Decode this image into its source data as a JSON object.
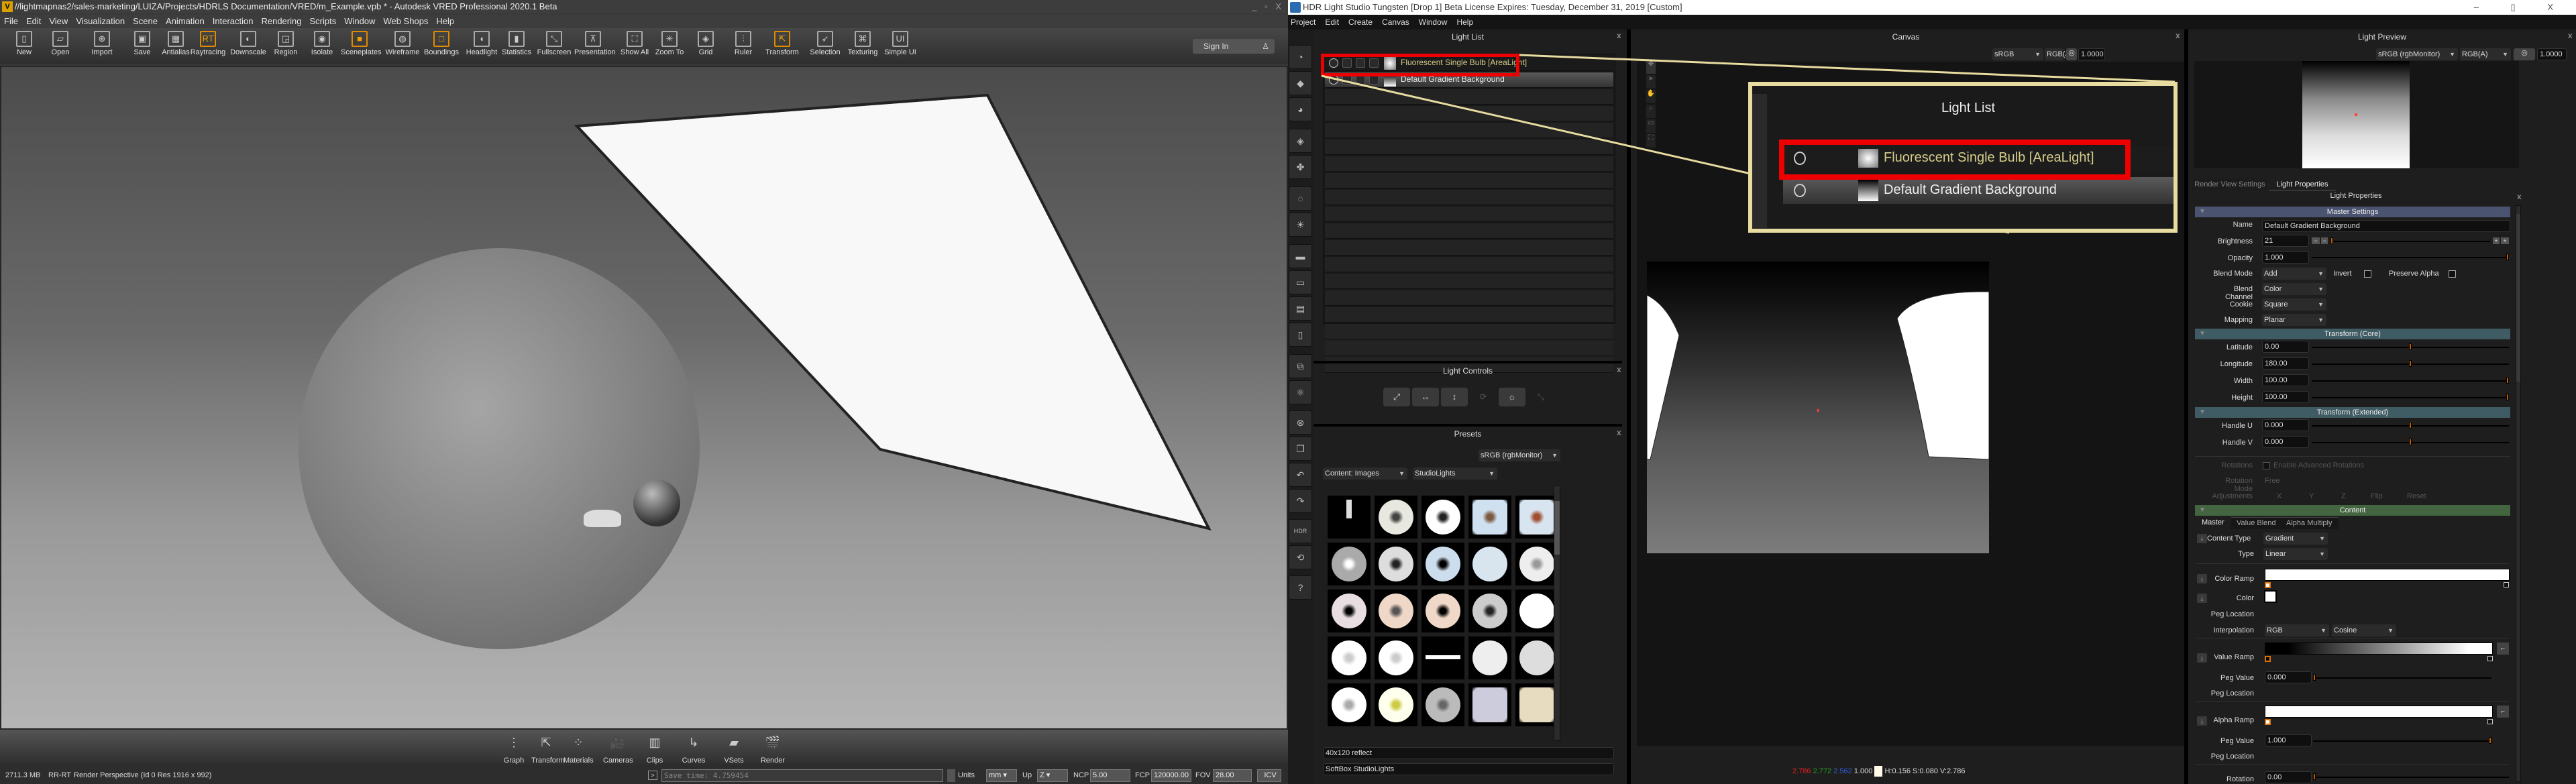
{
  "vred": {
    "title": "//lightmapnas2/sales-marketing/LUIZA/Projects/HDRLS Documentation/VRED/m_Example.vpb * - Autodesk VRED Professional 2020.1 Beta",
    "menu": [
      "File",
      "Edit",
      "View",
      "Visualization",
      "Scene",
      "Animation",
      "Interaction",
      "Rendering",
      "Scripts",
      "Window",
      "Web Shops",
      "Help"
    ],
    "toolbar": [
      {
        "label": "New",
        "icon": "new-file-icon",
        "glyph": "▯"
      },
      {
        "label": "Open",
        "icon": "open-folder-icon",
        "glyph": "▱"
      },
      {
        "label": "Import",
        "icon": "import-icon",
        "glyph": "⊕"
      },
      {
        "label": "Save",
        "icon": "save-icon",
        "glyph": "▣"
      },
      {
        "label": "Antialias",
        "icon": "antialias-icon",
        "glyph": "▦"
      },
      {
        "label": "Raytracing",
        "icon": "raytracing-icon",
        "glyph": "RT"
      },
      {
        "label": "Downscale",
        "icon": "downscale-icon",
        "glyph": "◐"
      },
      {
        "label": "Region",
        "icon": "region-icon",
        "glyph": "◲"
      },
      {
        "label": "Isolate",
        "icon": "isolate-icon",
        "glyph": "◉"
      },
      {
        "label": "Sceneplates",
        "icon": "sceneplates-icon",
        "glyph": "■"
      },
      {
        "label": "Wireframe",
        "icon": "wireframe-icon",
        "glyph": "◍"
      },
      {
        "label": "Boundings",
        "icon": "boundings-icon",
        "glyph": "□"
      },
      {
        "label": "Headlight",
        "icon": "headlight-icon",
        "glyph": "◖"
      },
      {
        "label": "Statistics",
        "icon": "statistics-icon",
        "glyph": "▮"
      },
      {
        "label": "Fullscreen",
        "icon": "fullscreen-icon",
        "glyph": "⤡"
      },
      {
        "label": "Presentation",
        "icon": "presentation-icon",
        "glyph": "⊼"
      },
      {
        "label": "Show All",
        "icon": "show-all-icon",
        "glyph": "⛶"
      },
      {
        "label": "Zoom To",
        "icon": "zoom-to-icon",
        "glyph": "✳"
      },
      {
        "label": "Grid",
        "icon": "grid-icon",
        "glyph": "◈"
      },
      {
        "label": "Ruler",
        "icon": "ruler-icon",
        "glyph": "⫶"
      },
      {
        "label": "Transform",
        "icon": "transform-icon",
        "glyph": "⇱"
      },
      {
        "label": "Selection",
        "icon": "selection-icon",
        "glyph": "➶"
      },
      {
        "label": "Texturing",
        "icon": "texturing-icon",
        "glyph": "⌘"
      },
      {
        "label": "Simple UI",
        "icon": "simple-ui-icon",
        "glyph": "UI"
      }
    ],
    "sign_in": "Sign In",
    "dock": [
      {
        "label": "Graph",
        "icon": "graph-icon",
        "glyph": "⋮"
      },
      {
        "label": "Transform",
        "icon": "transform-icon",
        "glyph": "⇱"
      },
      {
        "label": "Materials",
        "icon": "materials-icon",
        "glyph": "⁘"
      },
      {
        "label": "Cameras",
        "icon": "cameras-icon",
        "glyph": "🎥"
      },
      {
        "label": "Clips",
        "icon": "clips-icon",
        "glyph": "▥"
      },
      {
        "label": "Curves",
        "icon": "curves-icon",
        "glyph": "↳"
      },
      {
        "label": "VSets",
        "icon": "vsets-icon",
        "glyph": "▰"
      },
      {
        "label": "Render",
        "icon": "render-icon",
        "glyph": "🎬"
      }
    ],
    "status": {
      "memory": "2711.3 MB",
      "mode": "RR-RT",
      "render": "Render Perspective (Id 0 Res 1916 x 992)",
      "console": "Save time: 4.759454",
      "units_label": "Units",
      "units": "mm",
      "up_label": "Up",
      "up": "Z",
      "ncp_label": "NCP",
      "ncp": "5.00",
      "fcp_label": "FCP",
      "fcp": "120000.00",
      "fov_label": "FOV",
      "fov": "28.00",
      "icv": "ICV"
    }
  },
  "hdr": {
    "title": "HDR Light Studio Tungsten [Drop 1] Beta License Expires: Tuesday, December 31, 2019  [Custom]",
    "menu": [
      "Project",
      "Edit",
      "Create",
      "Canvas",
      "Window",
      "Help"
    ],
    "light_list": {
      "title": "Light List",
      "items": [
        {
          "name": "Fluorescent Single Bulb [AreaLight]",
          "selected": true
        },
        {
          "name": "Default Gradient Background",
          "selected": false
        }
      ]
    },
    "light_controls": {
      "title": "Light Controls"
    },
    "presets": {
      "title": "Presets",
      "color_space": "sRGB (rgbMonitor)",
      "content": "Content: Images",
      "category": "StudioLights",
      "selected_name": "40x120 reflect",
      "selected_category": "SoftBox StudioLights"
    },
    "canvas": {
      "title": "Canvas",
      "color_space": "sRGB (rgbMonitor)",
      "channel": "RGB(A)",
      "exposure": "1.0000",
      "callout_title": "Light List",
      "readout": {
        "r": "2.786",
        "g": "2.772",
        "b": "2.562",
        "a": "1.000",
        "hsv": "H:0.156 S:0.080 V:2.786"
      }
    },
    "light_preview": {
      "title": "Light Preview",
      "color_space": "sRGB (rgbMonitor)",
      "channel": "RGB(A)",
      "exposure": "1.0000"
    },
    "props": {
      "tabs": [
        "Render View Settings",
        "Light Properties"
      ],
      "title": "Light Properties",
      "master_settings": "Master Settings",
      "name_label": "Name",
      "name": "Default Gradient Background",
      "brightness_label": "Brightness",
      "brightness": "21",
      "opacity_label": "Opacity",
      "opacity": "1.000",
      "blend_mode_label": "Blend Mode",
      "blend_mode": "Add",
      "invert_label": "Invert",
      "preserve_alpha_label": "Preserve Alpha",
      "blend_channel_label": "Blend Channel",
      "blend_channel": "Color",
      "cookie_label": "Cookie",
      "cookie": "Square",
      "mapping_label": "Mapping",
      "mapping": "Planar",
      "transform_core": "Transform (Core)",
      "latitude_label": "Latitude",
      "latitude": "0.00",
      "longitude_label": "Longitude",
      "longitude": "180.00",
      "width_label": "Width",
      "width": "100.00",
      "height_label": "Height",
      "height": "100.00",
      "transform_ext": "Transform (Extended)",
      "handle_u_label": "Handle U",
      "handle_u": "0.000",
      "handle_v_label": "Handle V",
      "handle_v": "0.000",
      "rotations_label": "Rotations",
      "enable_adv_rot": "Enable Advanced Rotations",
      "rotation_mode_label": "Rotation Mode",
      "rotation_mode": "Free",
      "adjustments_label": "Adjustments",
      "adj_x": "X",
      "adj_y": "Y",
      "adj_z": "Z",
      "flip": "Flip",
      "reset": "Reset",
      "content": "Content",
      "content_tabs": [
        "Master",
        "Value Blend",
        "Alpha Multiply"
      ],
      "content_type_label": "Content Type",
      "content_type": "Gradient",
      "type_label": "Type",
      "type": "Linear",
      "color_ramp_label": "Color Ramp",
      "color_label": "Color",
      "peg_location_label": "Peg Location",
      "interpolation_label": "Interpolation",
      "interpolation": "RGB",
      "interpolation_curve": "Cosine",
      "value_ramp_label": "Value Ramp",
      "peg_value_label": "Peg Value",
      "value_peg_value": "0.000",
      "alpha_ramp_label": "Alpha Ramp",
      "alpha_peg_value": "1.000",
      "rotation_label": "Rotation",
      "rotation": "0.00"
    },
    "slider_fractions": {
      "brightness": 0.0,
      "opacity": 1.0,
      "latitude": 0.5,
      "longitude": 0.5,
      "width": 1.0,
      "height": 1.0,
      "handle_u": 0.5,
      "handle_v": 0.5,
      "value_peg": 0.0,
      "alpha_peg": 1.0,
      "rotation": 0.0
    },
    "colors": {
      "accent": "#c35a00",
      "highlight_box": "#ee0000",
      "callout": "#e8dca0",
      "master_section": "#4a5470",
      "transform_section": "#3f5b63",
      "content_section": "#436640"
    }
  }
}
